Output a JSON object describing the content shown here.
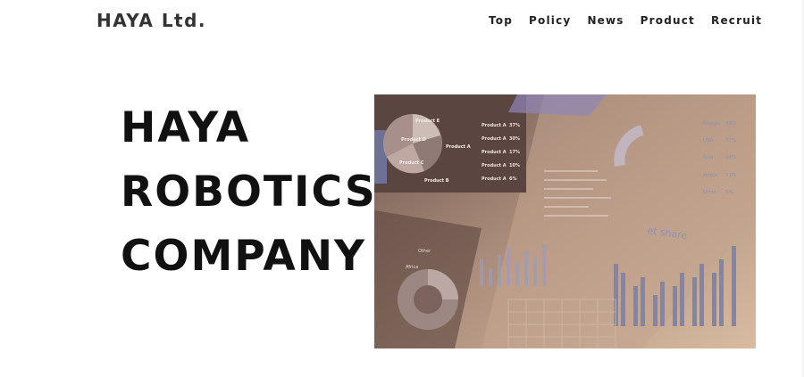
{
  "header": {
    "logo": "HAYA Ltd."
  },
  "nav": [
    "Top",
    "Policy",
    "News",
    "Product",
    "Recruit"
  ],
  "hero": {
    "title_lines": [
      "HAYA",
      "ROBOTICS",
      "COMPANY"
    ]
  },
  "hero_image": {
    "pie_labels": [
      "Product E",
      "Product D",
      "Product A",
      "Product C",
      "Product B"
    ],
    "product_list": [
      {
        "name": "Product A",
        "pct": "37%"
      },
      {
        "name": "Product A",
        "pct": "30%"
      },
      {
        "name": "Product A",
        "pct": "17%"
      },
      {
        "name": "Product A",
        "pct": "10%"
      },
      {
        "name": "Product A",
        "pct": "6%"
      }
    ],
    "region_list": [
      {
        "name": "Europe",
        "pct": "38%"
      },
      {
        "name": "USA",
        "pct": "32%"
      },
      {
        "name": "Asia",
        "pct": "14%"
      },
      {
        "name": "Africa",
        "pct": "11%"
      },
      {
        "name": "Other",
        "pct": "5%"
      }
    ],
    "share_text": "et share",
    "donut_labels": [
      "Other",
      "Africa"
    ]
  },
  "colors": {
    "text": "#111111",
    "logo": "#333333"
  }
}
